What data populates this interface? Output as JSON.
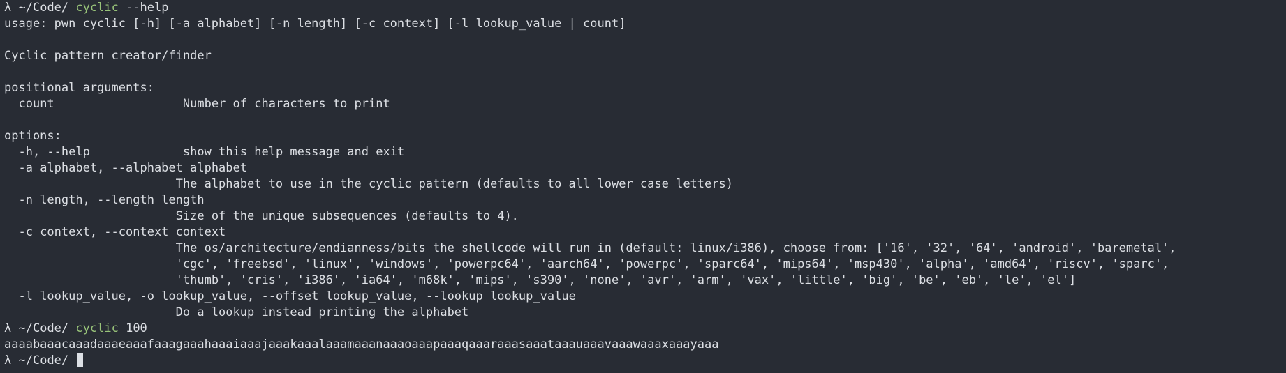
{
  "colors": {
    "background": "#282c34",
    "foreground": "#dcdfe4",
    "command": "#98c379"
  },
  "prompt1": {
    "symbol": "λ",
    "path": "~/Code/",
    "command": "cyclic",
    "args": "--help"
  },
  "help": {
    "usage": "usage: pwn cyclic [-h] [-a alphabet] [-n length] [-c context] [-l lookup_value | count]",
    "description": "Cyclic pattern creator/finder",
    "positional_heading": "positional arguments:",
    "positional": [
      {
        "flag": "count",
        "help": "Number of characters to print"
      }
    ],
    "options_heading": "options:",
    "options": [
      {
        "flag": "-h, --help",
        "help": "show this help message and exit"
      },
      {
        "flag": "-a alphabet, --alphabet alphabet",
        "help": "The alphabet to use in the cyclic pattern (defaults to all lower case letters)"
      },
      {
        "flag": "-n length, --length length",
        "help": "Size of the unique subsequences (defaults to 4)."
      },
      {
        "flag": "-c context, --context context",
        "help": "The os/architecture/endianness/bits the shellcode will run in (default: linux/i386), choose from: ['16', '32', '64', 'android', 'baremetal',",
        "help2": "'cgc', 'freebsd', 'linux', 'windows', 'powerpc64', 'aarch64', 'powerpc', 'sparc64', 'mips64', 'msp430', 'alpha', 'amd64', 'riscv', 'sparc',",
        "help3": "'thumb', 'cris', 'i386', 'ia64', 'm68k', 'mips', 's390', 'none', 'avr', 'arm', 'vax', 'little', 'big', 'be', 'eb', 'le', 'el']"
      },
      {
        "flag": "-l lookup_value, -o lookup_value, --offset lookup_value, --lookup lookup_value",
        "help": "Do a lookup instead printing the alphabet"
      }
    ]
  },
  "prompt2": {
    "symbol": "λ",
    "path": "~/Code/",
    "command": "cyclic",
    "args": "100"
  },
  "output": "aaaabaaacaaadaaaeaaafaaagaaahaaaiaaajaaakaaalaaamaaanaaaoaaapaaaqaaaraaasaaataaauaaavaaawaaaxaaayaaa",
  "prompt3": {
    "symbol": "λ",
    "path": "~/Code/"
  }
}
